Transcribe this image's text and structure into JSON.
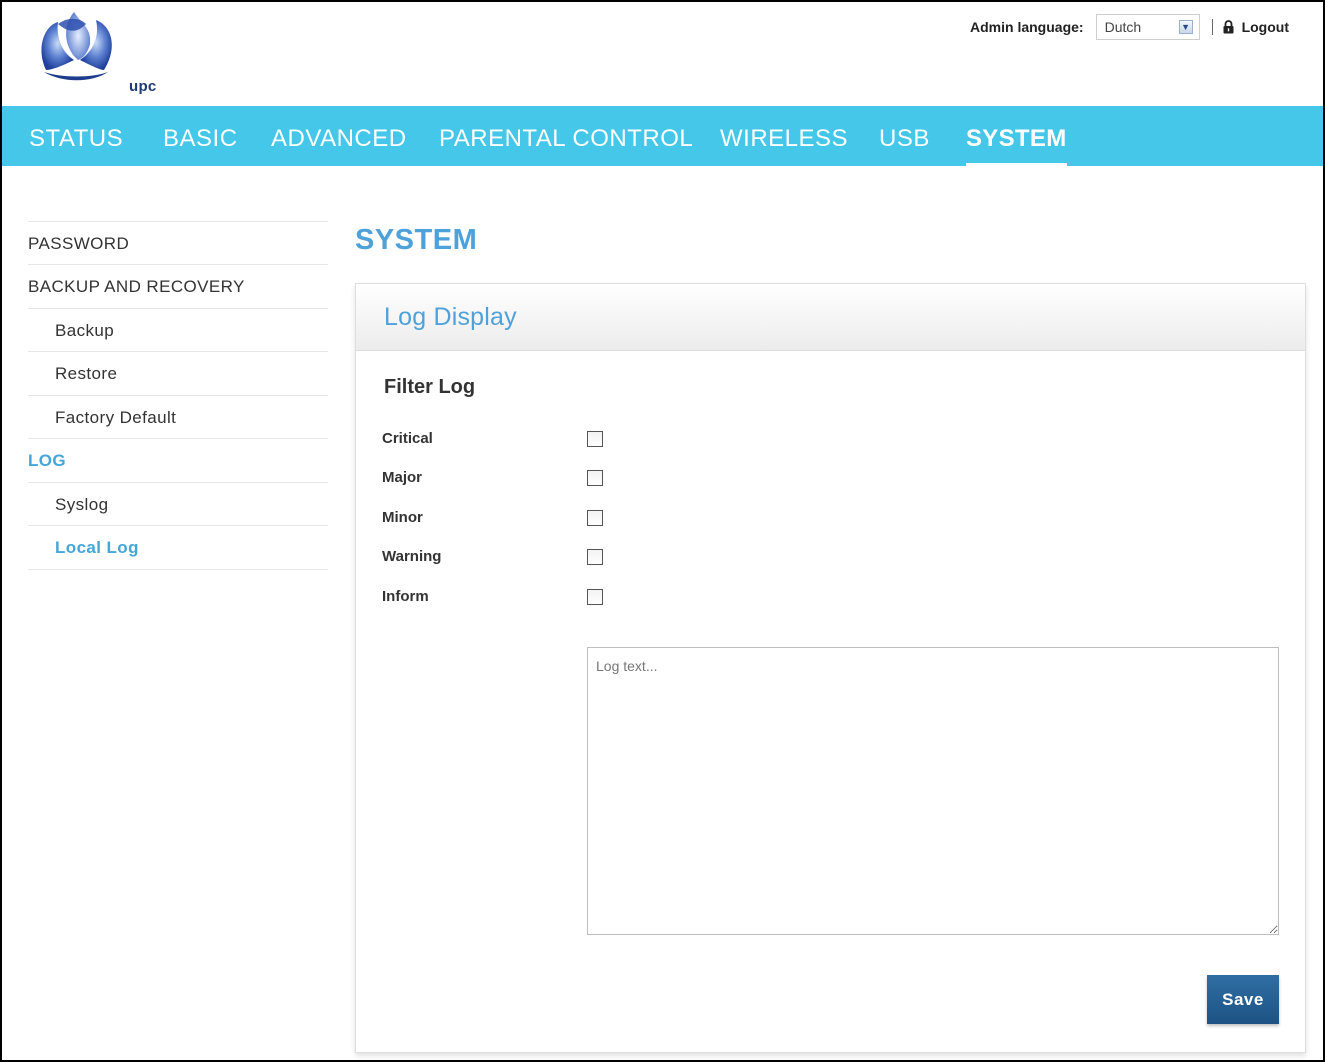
{
  "header": {
    "brand": "upc",
    "admin_language_label": "Admin language:",
    "language_value": "Dutch",
    "logout_label": "Logout"
  },
  "nav": {
    "items": [
      {
        "label": "STATUS"
      },
      {
        "label": "BASIC"
      },
      {
        "label": "ADVANCED"
      },
      {
        "label": "PARENTAL CONTROL"
      },
      {
        "label": "WIRELESS"
      },
      {
        "label": "USB"
      },
      {
        "label": "SYSTEM",
        "active": true
      }
    ]
  },
  "sidebar": {
    "items": [
      {
        "label": "PASSWORD",
        "level": 0
      },
      {
        "label": "BACKUP AND RECOVERY",
        "level": 0
      },
      {
        "label": "Backup",
        "level": 1
      },
      {
        "label": "Restore",
        "level": 1
      },
      {
        "label": "Factory Default",
        "level": 1
      },
      {
        "label": "LOG",
        "level": 0,
        "active": true
      },
      {
        "label": "Syslog",
        "level": 1
      },
      {
        "label": "Local Log",
        "level": 1,
        "active": true
      }
    ]
  },
  "main": {
    "page_title": "SYSTEM",
    "panel_title": "Log Display",
    "filter_title": "Filter Log",
    "filters": [
      {
        "label": "Critical",
        "checked": false
      },
      {
        "label": "Major",
        "checked": false
      },
      {
        "label": "Minor",
        "checked": false
      },
      {
        "label": "Warning",
        "checked": false
      },
      {
        "label": "Inform",
        "checked": false
      }
    ],
    "log_placeholder": "Log text...",
    "save_label": "Save"
  },
  "colors": {
    "nav_bg": "#44c7e8",
    "accent": "#4ea1d9",
    "button": "#1d5384"
  }
}
